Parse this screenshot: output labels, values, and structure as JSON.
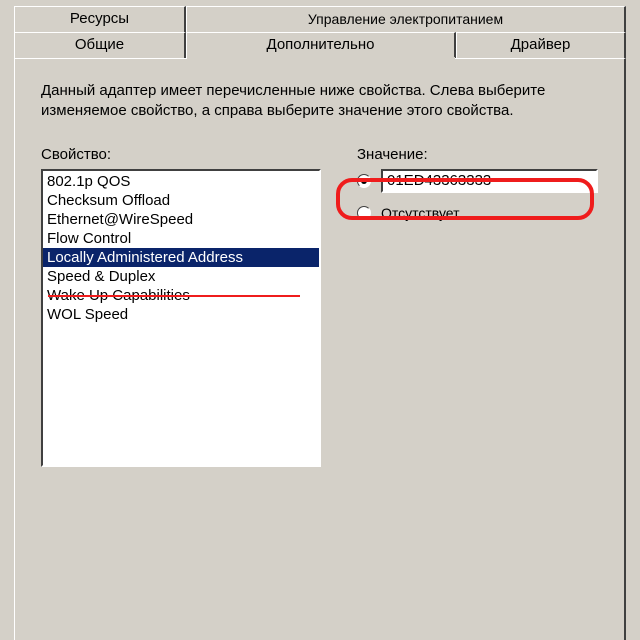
{
  "tabs": {
    "row1": [
      "Ресурсы",
      "Управление электропитанием"
    ],
    "row2": [
      "Общие",
      "Дополнительно",
      "Драйвер"
    ],
    "active": "Дополнительно"
  },
  "description": "Данный адаптер имеет перечисленные ниже свойства. Слева выберите изменяемое свойство, а справа выберите значение этого свойства.",
  "property": {
    "label": "Свойство:",
    "items": [
      "802.1p QOS",
      "Checksum Offload",
      "Ethernet@WireSpeed",
      "Flow Control",
      "Locally Administered Address",
      "Speed & Duplex",
      "Wake Up Capabilities",
      "WOL Speed"
    ],
    "selected_index": 4
  },
  "value": {
    "label": "Значение:",
    "radio_value_checked": true,
    "text": "01ED43363333",
    "radio_absent_label": "Отсутствует",
    "radio_absent_checked": false
  },
  "annotations": {
    "highlight_value_field": true,
    "underline_selected_property": true
  }
}
